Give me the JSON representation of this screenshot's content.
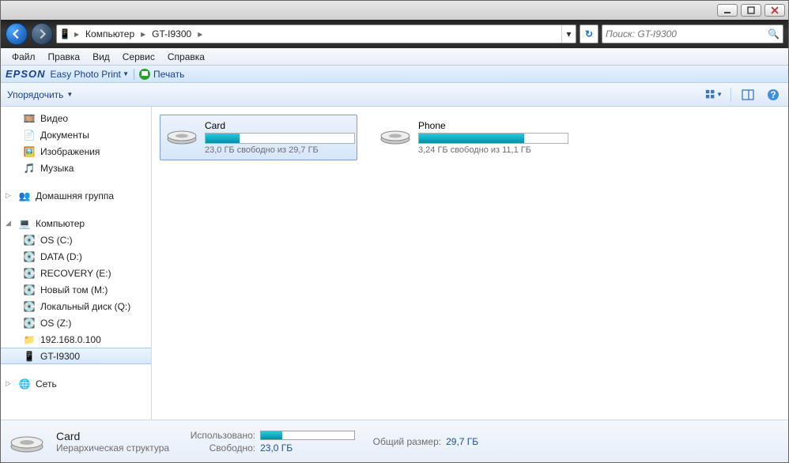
{
  "breadcrumbs": {
    "root": "Компьютер",
    "here": "GT-I9300"
  },
  "search": {
    "placeholder": "Поиск: GT-I9300"
  },
  "menu": {
    "file": "Файл",
    "edit": "Правка",
    "view": "Вид",
    "tools": "Сервис",
    "help": "Справка"
  },
  "epson": {
    "brand": "EPSON",
    "easy": "Easy Photo Print",
    "print": "Печать"
  },
  "organize": {
    "label": "Упорядочить"
  },
  "tree": {
    "videos": "Видео",
    "documents": "Документы",
    "pictures": "Изображения",
    "music": "Музыка",
    "homegroup": "Домашняя группа",
    "computer": "Компьютер",
    "drives": {
      "c": "OS (C:)",
      "d": "DATA (D:)",
      "e": "RECOVERY (E:)",
      "m": "Новый том (M:)",
      "q": "Локальный диск (Q:)",
      "z": "OS (Z:)",
      "net": "192.168.0.100",
      "dev": "GT-I9300"
    },
    "network": "Сеть"
  },
  "content": {
    "card": {
      "name": "Card",
      "free": "23,0 ГБ свободно из 29,7 ГБ",
      "fill_pct": 23
    },
    "phone": {
      "name": "Phone",
      "free": "3,24 ГБ свободно из 11,1 ГБ",
      "fill_pct": 71
    }
  },
  "details": {
    "name": "Card",
    "type": "Иерархическая структура",
    "used_k": "Использовано:",
    "used_fill_pct": 23,
    "free_k": "Свободно:",
    "free_v": "23,0 ГБ",
    "total_k": "Общий размер:",
    "total_v": "29,7 ГБ"
  }
}
